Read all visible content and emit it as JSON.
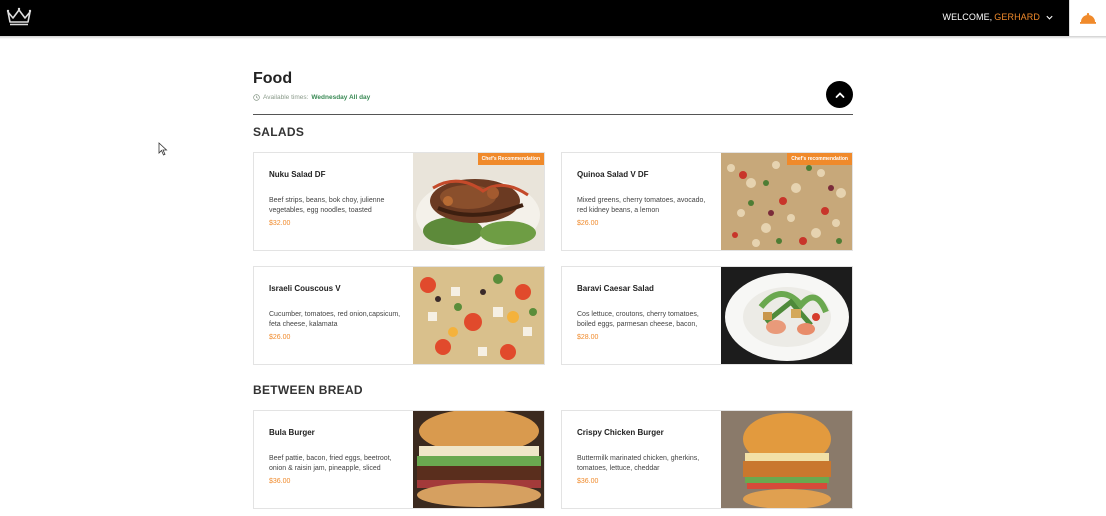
{
  "header": {
    "welcome_label": "WELCOME,",
    "user_name": "GERHARD"
  },
  "menu": {
    "title": "Food",
    "available_label": "Available times:",
    "available_value": "Wednesday All day"
  },
  "sections": [
    {
      "title": "SALADS",
      "items": [
        {
          "name": "Nuku Salad DF",
          "description": "Beef strips, beans, bok choy, julienne vegetables, egg noodles, toasted",
          "price": "$32.00",
          "badge": "Chef's Recommendation"
        },
        {
          "name": "Quinoa Salad V DF",
          "description": "Mixed greens, cherry tomatoes, avocado, red kidney beans, a lemon",
          "price": "$26.00",
          "badge": "Chef's recommendation"
        },
        {
          "name": "Israeli Couscous V",
          "description": "Cucumber, tomatoes, red onion,capsicum, feta cheese, kalamata",
          "price": "$26.00"
        },
        {
          "name": "Baravi Caesar Salad",
          "description": "Cos lettuce, croutons, cherry tomatoes, boiled eggs, parmesan cheese, bacon,",
          "price": "$28.00"
        }
      ]
    },
    {
      "title": "BETWEEN BREAD",
      "items": [
        {
          "name": "Bula Burger",
          "description": "Beef pattie, bacon, fried eggs, beetroot, onion & raisin jam, pineapple, sliced",
          "price": "$36.00"
        },
        {
          "name": "Crispy Chicken Burger",
          "description": "Buttermilk marinated chicken, gherkins, tomatoes, lettuce, cheddar",
          "price": "$36.00"
        }
      ]
    }
  ],
  "colors": {
    "accent": "#f08a2b",
    "topbar": "#000000",
    "available_value": "#3a8a55"
  },
  "icons": [
    "crown-logo-icon",
    "chevron-down-icon",
    "cloche-icon",
    "clock-icon",
    "chevron-up-icon",
    "mouse-cursor-icon"
  ]
}
